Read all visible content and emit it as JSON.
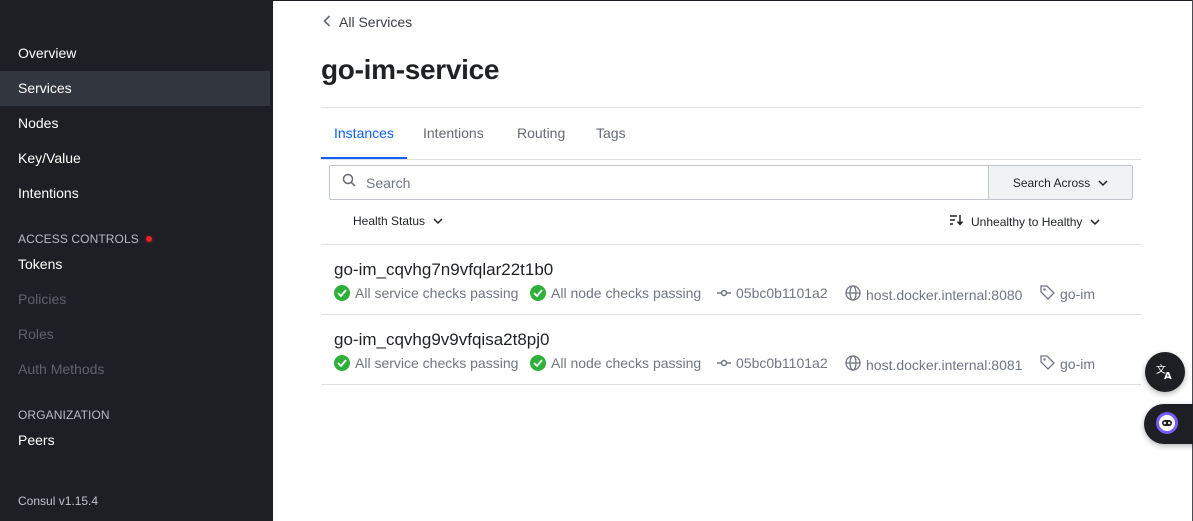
{
  "sidebar": {
    "items": [
      {
        "label": "Overview",
        "active": false,
        "enabled": true
      },
      {
        "label": "Services",
        "active": true,
        "enabled": true
      },
      {
        "label": "Nodes",
        "active": false,
        "enabled": true
      },
      {
        "label": "Key/Value",
        "active": false,
        "enabled": true
      },
      {
        "label": "Intentions",
        "active": false,
        "enabled": true
      }
    ],
    "access_controls": {
      "heading": "ACCESS CONTROLS",
      "items": [
        {
          "label": "Tokens",
          "enabled": true
        },
        {
          "label": "Policies",
          "enabled": false
        },
        {
          "label": "Roles",
          "enabled": false
        },
        {
          "label": "Auth Methods",
          "enabled": false
        }
      ]
    },
    "organization": {
      "heading": "ORGANIZATION",
      "items": [
        {
          "label": "Peers",
          "enabled": true
        }
      ]
    },
    "version": "Consul v1.15.4"
  },
  "breadcrumb": {
    "back_label": "All Services"
  },
  "page": {
    "title": "go-im-service"
  },
  "tabs": [
    {
      "label": "Instances",
      "active": true
    },
    {
      "label": "Intentions",
      "active": false
    },
    {
      "label": "Routing",
      "active": false
    },
    {
      "label": "Tags",
      "active": false
    }
  ],
  "search": {
    "placeholder": "Search",
    "value": "",
    "scope_button": "Search Across"
  },
  "filters": {
    "health_label": "Health Status",
    "sort_label": "Unhealthy to Healthy"
  },
  "instances": [
    {
      "name": "go-im_cqvhg7n9vfqlar22t1b0",
      "service_checks": "All service checks passing",
      "node_checks": "All node checks passing",
      "node": "05bc0b1101a2",
      "address": "host.docker.internal:8080",
      "tag": "go-im"
    },
    {
      "name": "go-im_cqvhg9v9vfqisa2t8pj0",
      "service_checks": "All service checks passing",
      "node_checks": "All node checks passing",
      "node": "05bc0b1101a2",
      "address": "host.docker.internal:8081",
      "tag": "go-im"
    }
  ],
  "colors": {
    "accent": "#1060ff",
    "sidebar_bg": "#1d1f24",
    "passing": "#2eb039",
    "alert": "#e52228"
  },
  "icons": {
    "back": "chevron-left-icon",
    "search": "search-icon",
    "dropdown": "chevron-down-icon",
    "sort": "sort-icon",
    "passing": "check-circle-icon",
    "node": "git-commit-icon",
    "address": "globe-icon",
    "tag": "tag-icon",
    "translate": "translate-icon",
    "assistant": "bot-icon"
  }
}
